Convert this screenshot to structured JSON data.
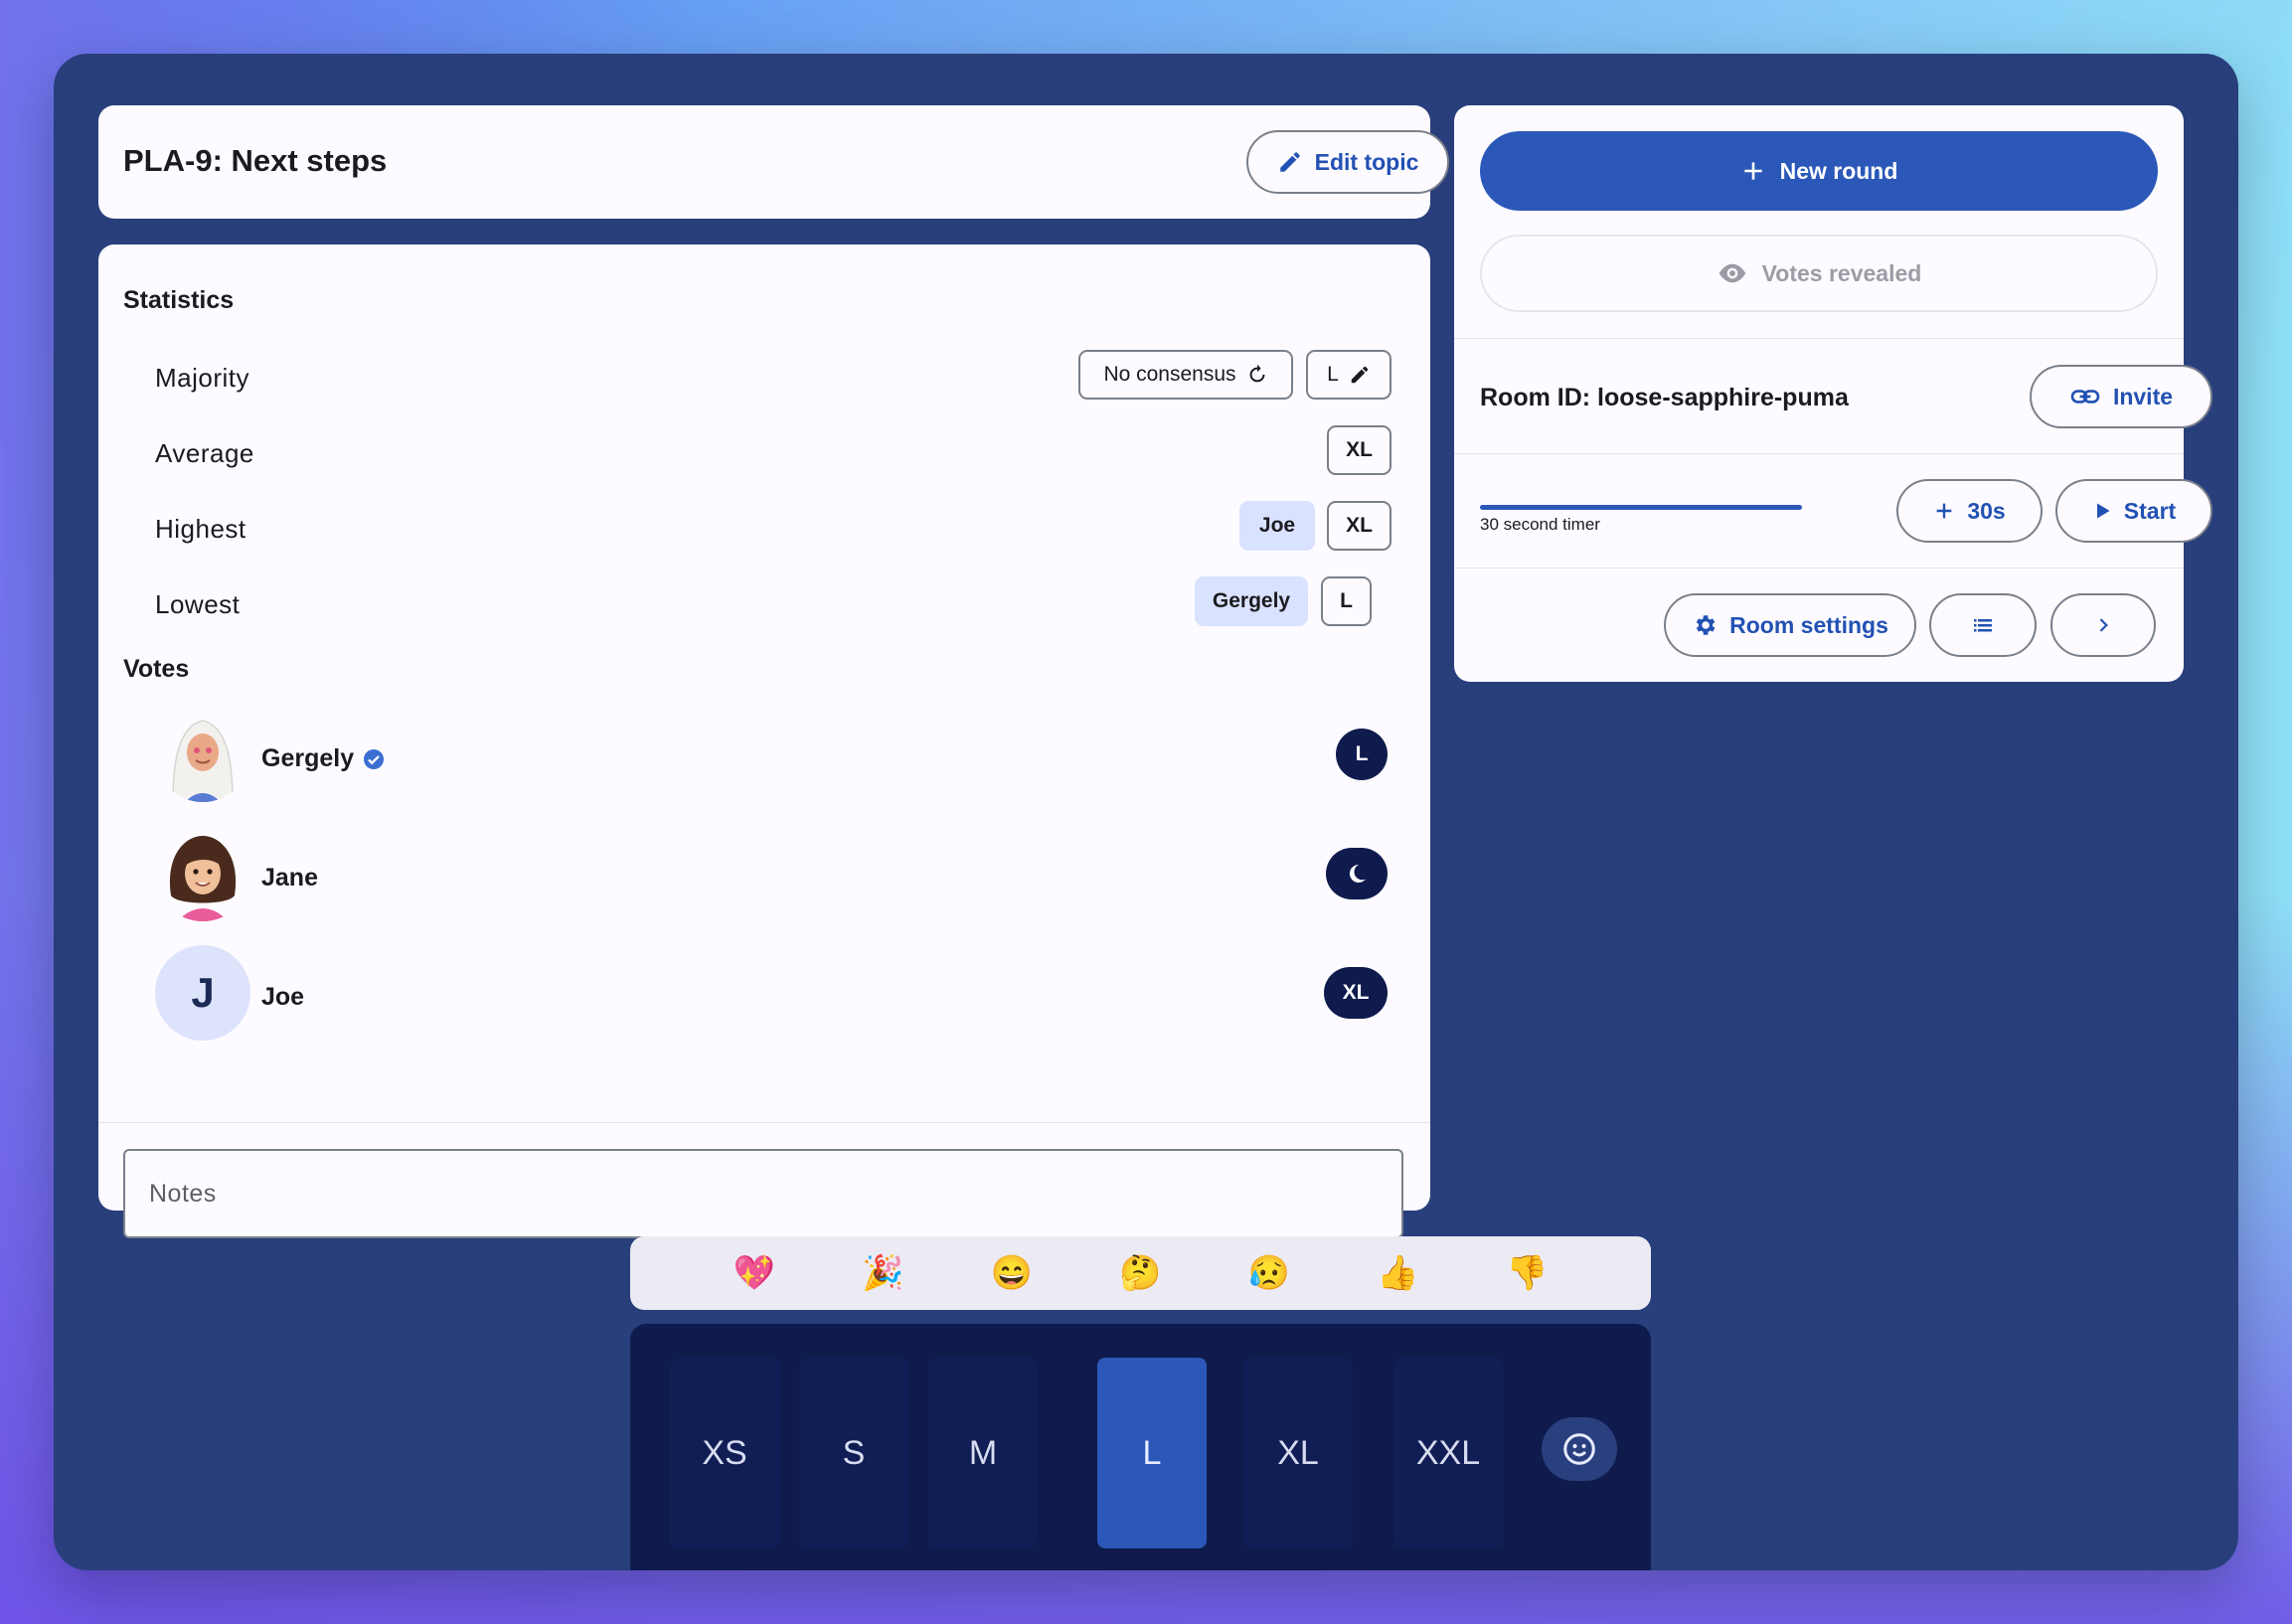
{
  "topic": {
    "title": "PLA-9: Next steps",
    "edit_label": "Edit topic"
  },
  "statistics": {
    "heading": "Statistics",
    "majority": {
      "label": "Majority",
      "consensus_label": "No consensus",
      "value": "L"
    },
    "average": {
      "label": "Average",
      "value": "XL"
    },
    "highest": {
      "label": "Highest",
      "user": "Joe",
      "value": "XL"
    },
    "lowest": {
      "label": "Lowest",
      "user": "Gergely",
      "value": "L"
    }
  },
  "votes": {
    "heading": "Votes",
    "items": [
      {
        "name": "Gergely",
        "verified": true,
        "vote": "L"
      },
      {
        "name": "Jane",
        "vote": "moon-icon"
      },
      {
        "name": "Joe",
        "initial": "J",
        "vote": "XL"
      }
    ]
  },
  "notes": {
    "placeholder": "Notes"
  },
  "controls": {
    "new_round_label": "New round",
    "votes_revealed_label": "Votes revealed",
    "room_id_text": "Room ID: loose-sapphire-puma",
    "invite_label": "Invite",
    "timer_label": "30 second timer",
    "timer_progress": 1.0,
    "add_time_label": "30s",
    "start_label": "Start",
    "room_settings_label": "Room settings"
  },
  "reactions": [
    "💖",
    "🎉",
    "😄",
    "🤔",
    "😥",
    "👍",
    "👎"
  ],
  "cards": {
    "options": [
      "XS",
      "S",
      "M",
      "L",
      "XL",
      "XXL"
    ],
    "selected": "L"
  },
  "colors": {
    "window_bg": "#283f7c",
    "primary": "#2b58b8",
    "badge_bg": "#0f1b4d",
    "chip_filled": "#d9e2ff"
  }
}
